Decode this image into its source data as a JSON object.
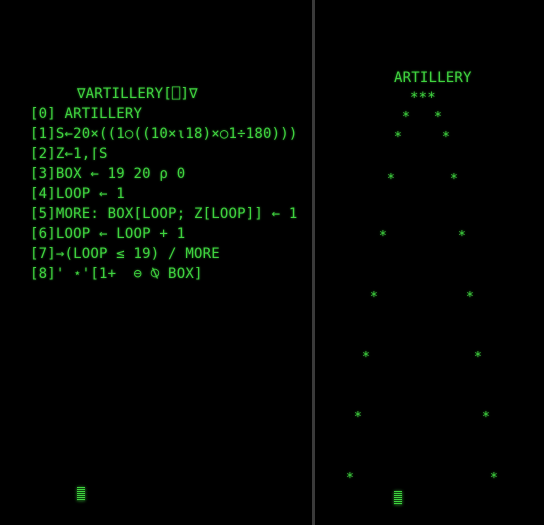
{
  "left_pane": {
    "header": "∇ARTILLERY[⎕]∇",
    "lines": [
      "[0] ARTILLERY",
      "[1]S←20×((1○((10×⍳18)×○1÷180)))",
      "[2]Z←1,⌈S",
      "[3]BOX ← 19 20 ⍴ 0",
      "[4]LOOP ← 1",
      "[5]MORE: BOX[LOOP; Z[LOOP]] ← 1",
      "[6]LOOP ← LOOP + 1",
      "[7]→(LOOP ≤ 19) / MORE",
      "[8]' ⋆'[1+  ⊖ ⍉ BOX]"
    ]
  },
  "right_pane": {
    "title": "ARTILLERY",
    "apex": "***",
    "trajectory_glyph": "*",
    "trajectory_point_count": 16
  },
  "colors": {
    "background": "#000000",
    "phosphor_green": "#3fd33f",
    "divider": "#3a3a3a"
  }
}
